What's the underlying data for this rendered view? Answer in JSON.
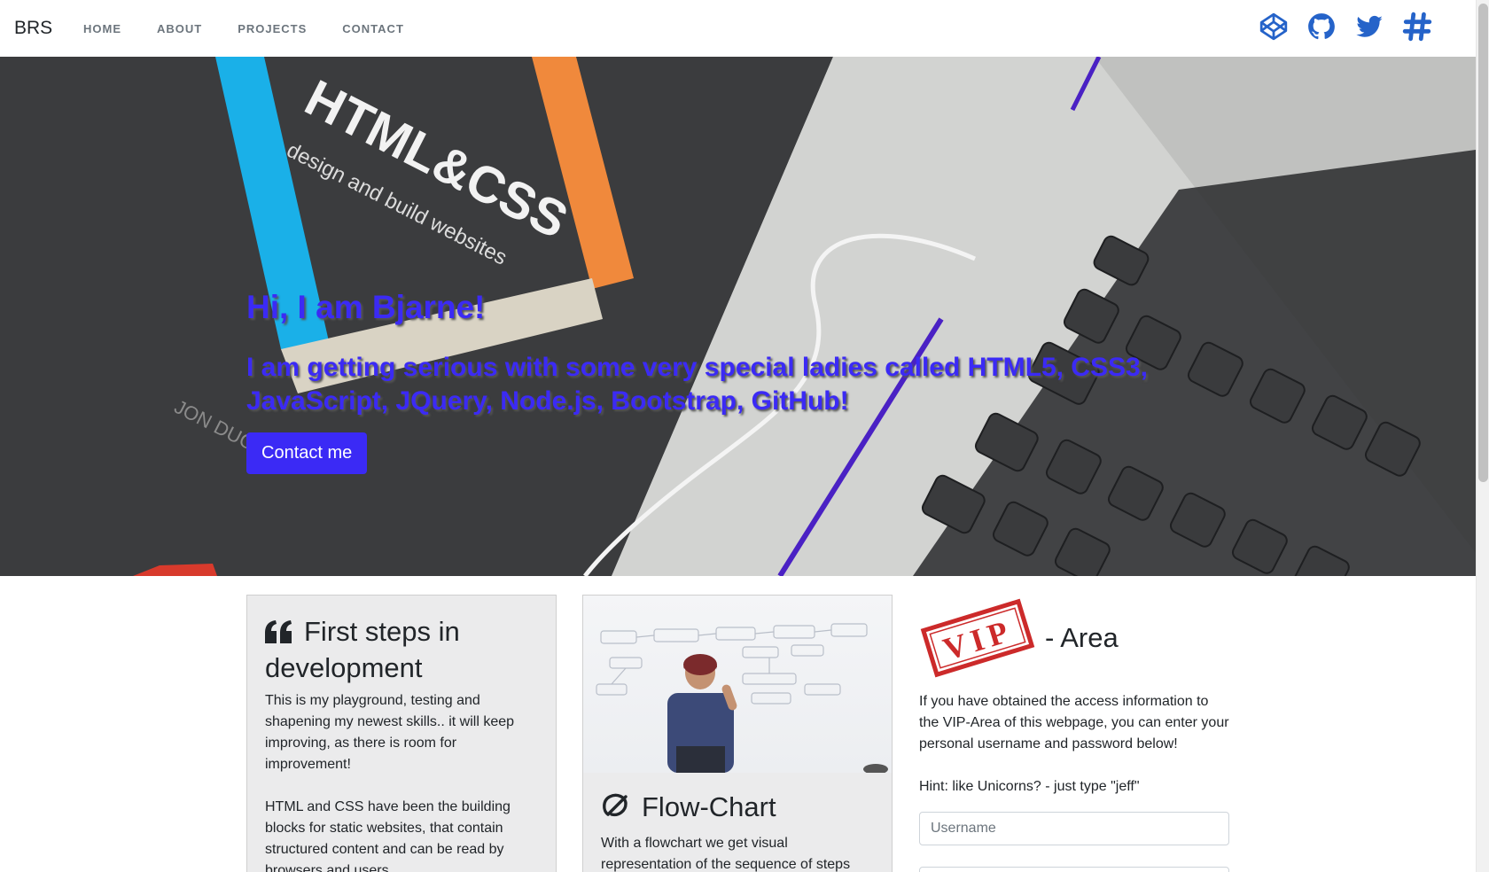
{
  "nav": {
    "brand": "BRS",
    "links": [
      "HOME",
      "ABOUT",
      "PROJECTS",
      "CONTACT"
    ],
    "icons": [
      "codepen-icon",
      "github-icon",
      "twitter-icon",
      "hashtag-icon"
    ],
    "icon_color": "#2563c9"
  },
  "hero": {
    "title": "Hi, I am Bjarne!",
    "subtitle": "I am getting serious with some very special ladies called HTML5, CSS3, JavaScript, JQuery, Node.js, Bootstrap, GitHub!",
    "button": "Contact me",
    "accent": "#3b2af5"
  },
  "cards": [
    {
      "icon": "quote-icon",
      "title": "First steps in development",
      "paragraphs": [
        "This is my playground, testing and shapening my newest skills.. it will keep improving, as there is room for improvement!",
        "HTML and CSS have been the building blocks for static websites, that contain structured content and can be read by browsers and users."
      ]
    },
    {
      "icon": "flow-icon",
      "title": "Flow-Chart",
      "paragraphs": [
        "With a flowchart we get visual representation of the sequence of steps"
      ]
    }
  ],
  "vip": {
    "stamp_text": "VIP",
    "title": "- Area",
    "text": "If you have obtained the access information to the VIP-Area of this webpage, you can enter your personal username and password below!",
    "hint": "Hint: like Unicorns? - just type \"jeff\"",
    "username_placeholder": "Username",
    "password_placeholder": ""
  }
}
